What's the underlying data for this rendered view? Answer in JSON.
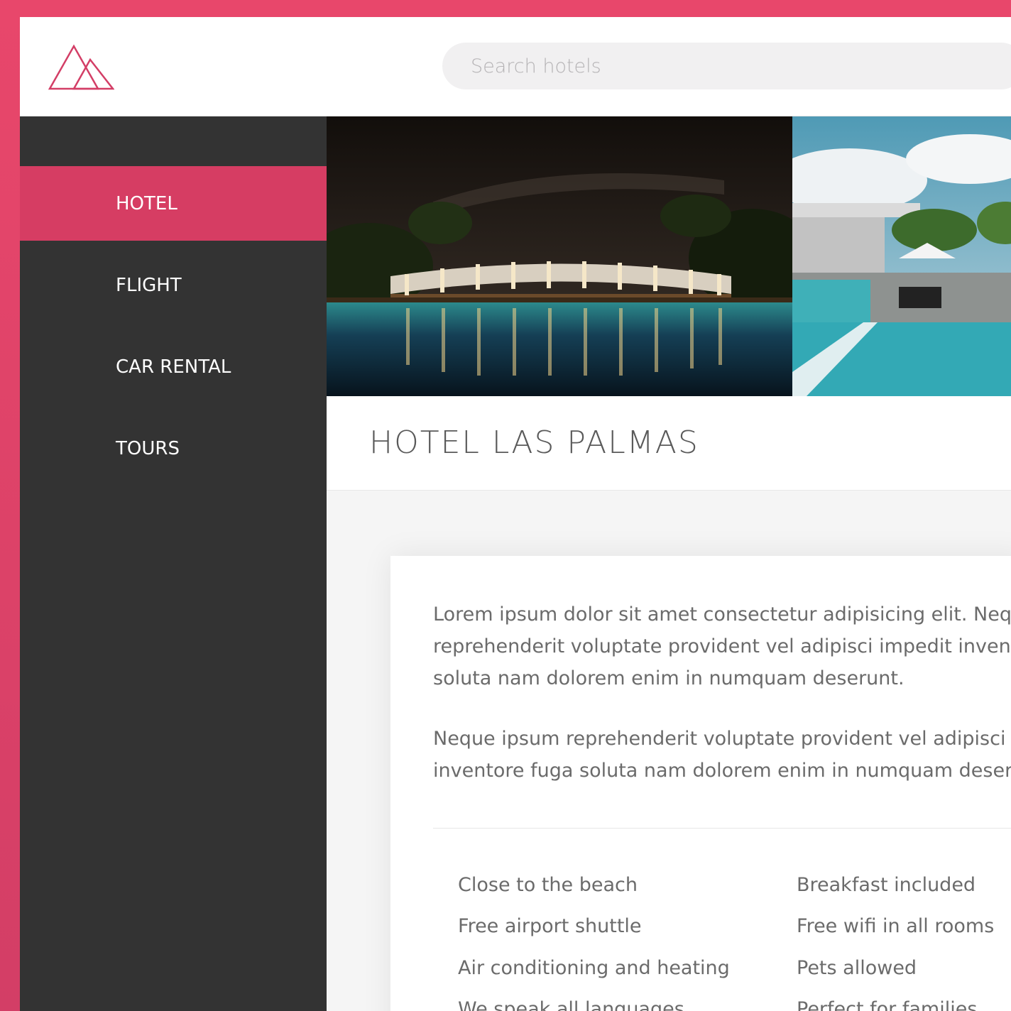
{
  "header": {
    "logo_icon": "mountain-logo-icon",
    "search": {
      "placeholder": "Search hotels",
      "value": ""
    }
  },
  "sidebar": {
    "items": [
      {
        "label": "HOTEL",
        "active": true
      },
      {
        "label": "FLIGHT",
        "active": false
      },
      {
        "label": "CAR RENTAL",
        "active": false
      },
      {
        "label": "TOURS",
        "active": false
      }
    ]
  },
  "hotel": {
    "name": "HOTEL LAS PALMAS",
    "description": [
      [
        "Lorem ipsum dolor sit amet consectetur adipisicing elit. Neque",
        "reprehenderit voluptate provident vel adipisci impedit inventor",
        "soluta nam dolorem enim in numquam deserunt."
      ],
      [
        "Neque ipsum reprehenderit voluptate provident vel adipisci im",
        "inventore fuga soluta nam dolorem enim in numquam deserur"
      ]
    ],
    "features_left": [
      "Close to the beach",
      "Free airport shuttle",
      "Air conditioning and heating",
      "We speak all languages"
    ],
    "features_right": [
      "Breakfast included",
      "Free wifi in all rooms",
      "Pets allowed",
      "Perfect for families"
    ]
  },
  "colors": {
    "brand": "#d63d63",
    "sidebar_bg": "#333333",
    "frame_top": "#e8476b",
    "frame_bottom": "#d33e66"
  }
}
